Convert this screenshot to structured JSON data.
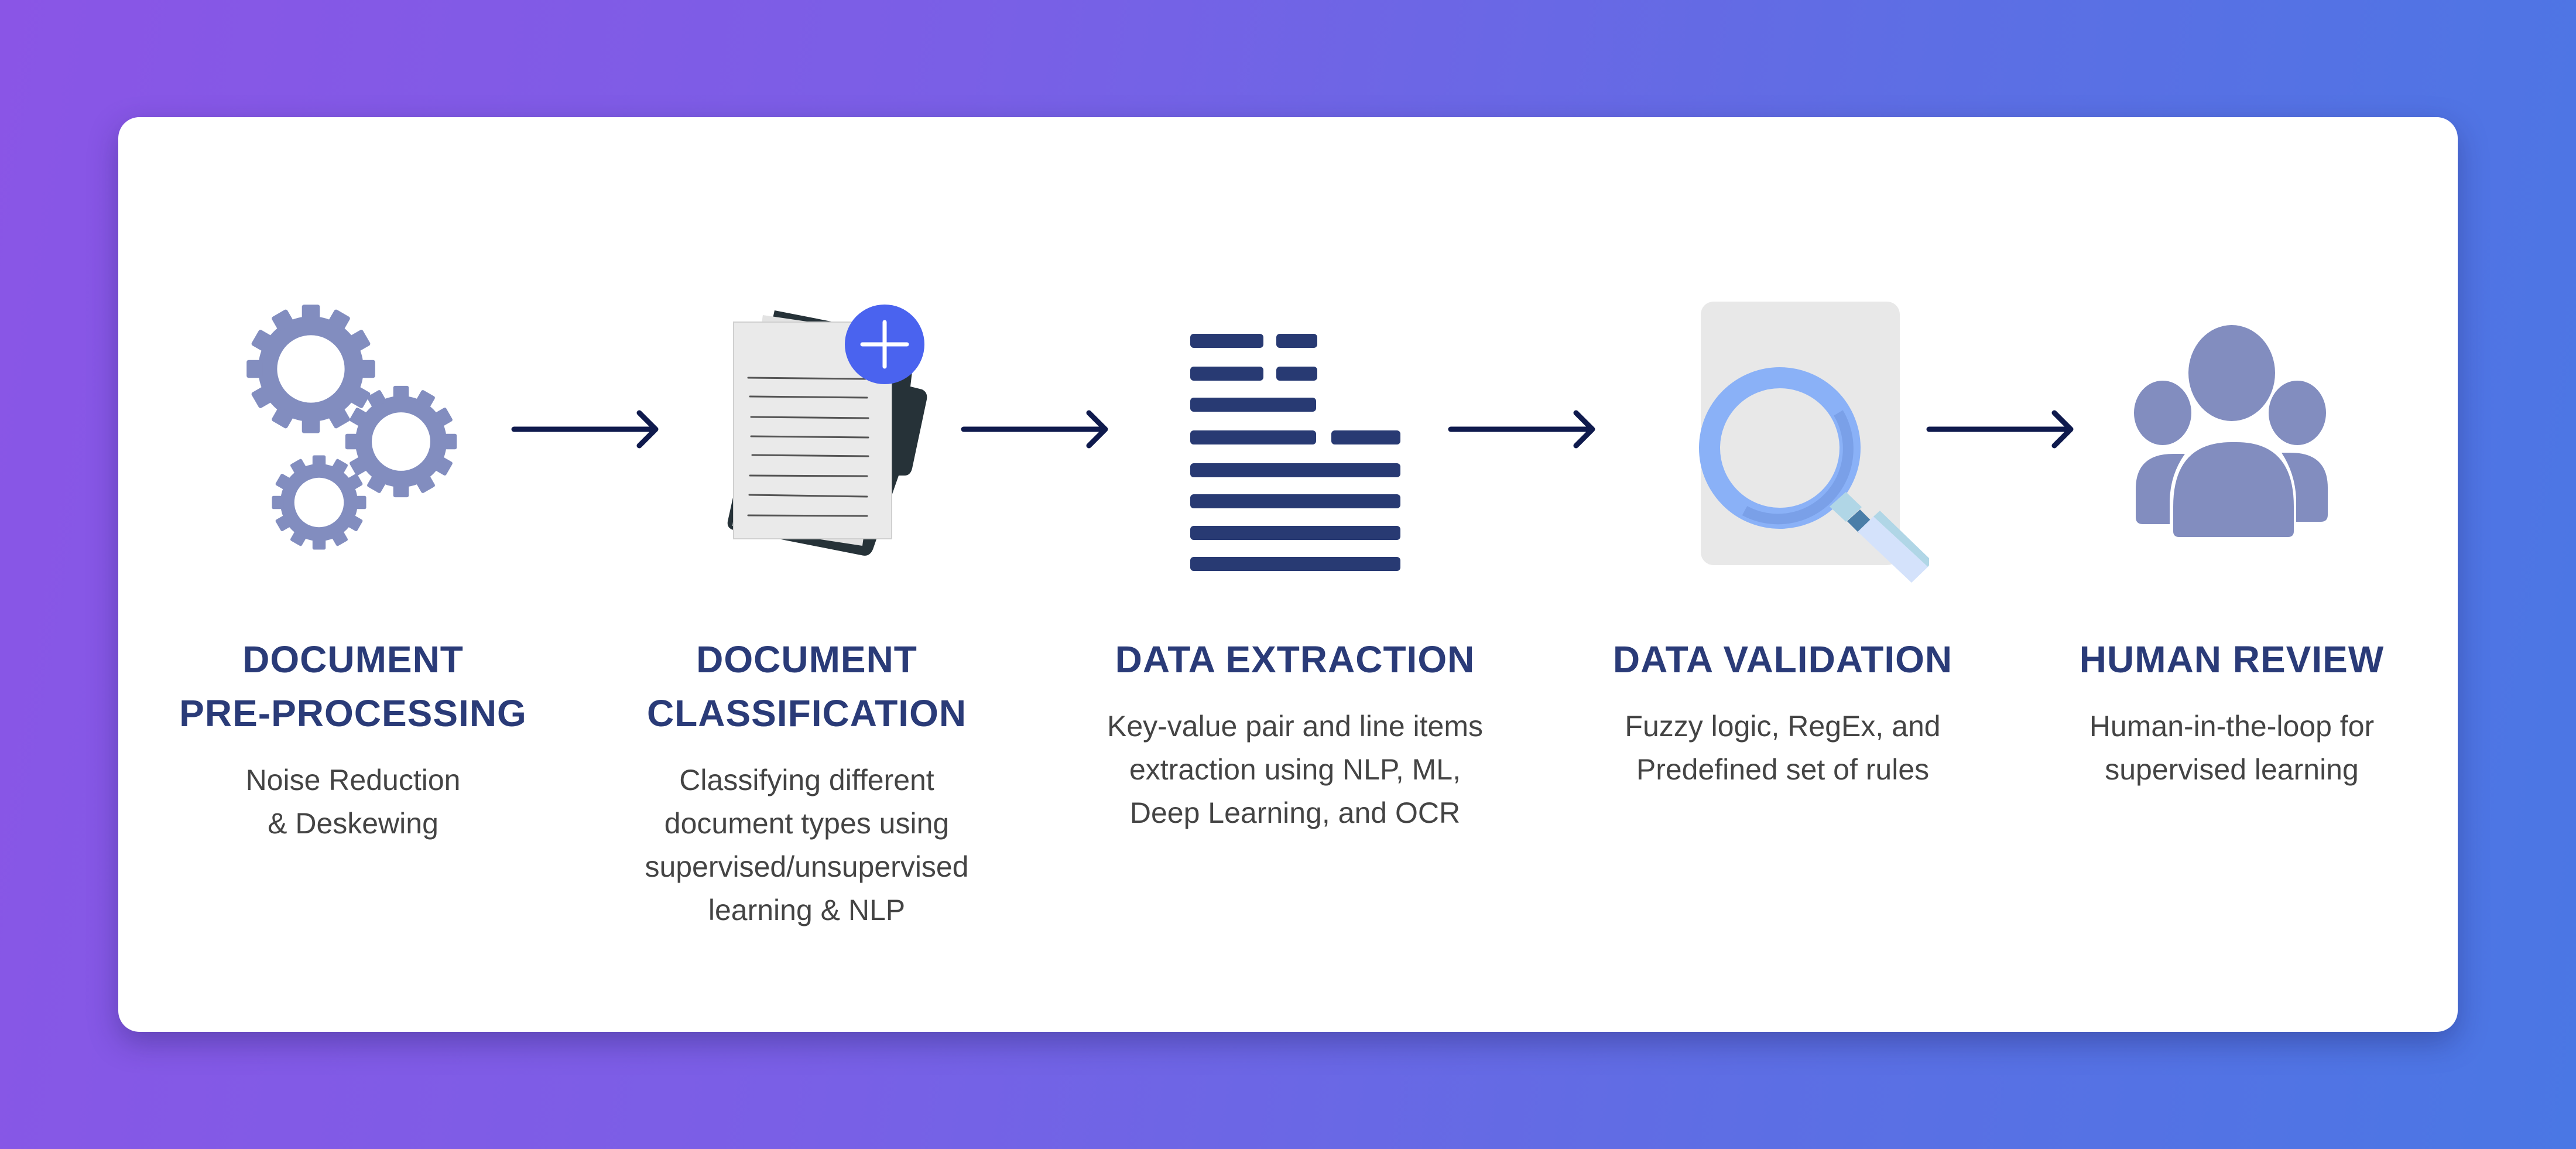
{
  "steps": [
    {
      "icon": "gears-icon",
      "title_lines": [
        "DOCUMENT",
        "PRE-PROCESSING"
      ],
      "desc_lines": [
        "Noise Reduction",
        "& Deskewing"
      ]
    },
    {
      "icon": "document-add-icon",
      "title_lines": [
        "DOCUMENT",
        "CLASSIFICATION"
      ],
      "desc_lines": [
        "Classifying different",
        "document types using",
        "supervised/unsupervised",
        "learning & NLP"
      ]
    },
    {
      "icon": "text-lines-icon",
      "title_lines": [
        "DATA EXTRACTION"
      ],
      "desc_lines": [
        "Key-value pair and line items",
        "extraction using NLP, ML,",
        "Deep Learning, and OCR"
      ]
    },
    {
      "icon": "magnifier-document-icon",
      "title_lines": [
        "DATA VALIDATION"
      ],
      "desc_lines": [
        "Fuzzy logic, RegEx, and",
        "Predefined set of rules"
      ]
    },
    {
      "icon": "users-group-icon",
      "title_lines": [
        "HUMAN REVIEW"
      ],
      "desc_lines": [
        "Human-in-the-loop for",
        "supervised learning"
      ]
    }
  ],
  "arrows": [
    "arrow-right-icon",
    "arrow-right-icon",
    "arrow-right-icon",
    "arrow-right-icon"
  ],
  "colors": {
    "background_start": "#8a55e6",
    "background_end": "#4a77e4",
    "card": "#ffffff",
    "title": "#2a3b78",
    "description": "#444444",
    "icon_lavender": "#828dbf",
    "icon_navy": "#283a73",
    "arrow": "#0f1a4d",
    "plus_badge": "#4a63ef",
    "magnifier": "#8ab1f7"
  }
}
